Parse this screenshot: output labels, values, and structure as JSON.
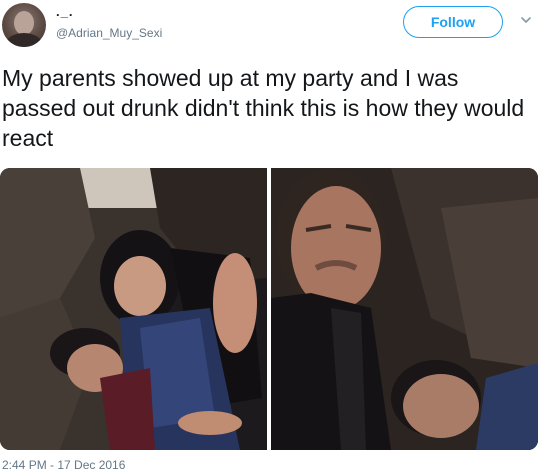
{
  "tweet": {
    "display_name": "._.",
    "handle": "@Adrian_Muy_Sexi",
    "follow_label": "Follow",
    "text": "My parents showed up at my party and I was passed out drunk didn't think this is how they would react",
    "timestamp": "2:44 PM - 17 Dec 2016"
  },
  "icons": {
    "avatar": "profile-photo",
    "menu": "chevron-down-icon"
  },
  "colors": {
    "accent": "#1da1f2",
    "text": "#14171a",
    "secondary_text": "#657786"
  },
  "media": {
    "photo_count": 2
  }
}
